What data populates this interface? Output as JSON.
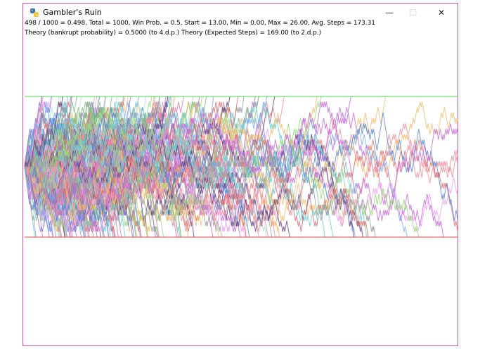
{
  "window": {
    "title": "Gambler's Ruin",
    "icon": "python-icon",
    "controls": {
      "minimize": "—",
      "maximize": "☐",
      "close": "✕"
    }
  },
  "stats_line": "498 / 1000 = 0.498, Total = 1000, Win Prob. = 0.5, Start = 13.00, Min = 0.00, Max = 26.00, Avg. Steps = 173.31",
  "theory_line": "Theory (bankrupt probability) = 0.5000 (to 4.d.p.)  Theory (Expected Steps) = 169.00 (to 2.d.p.)",
  "chart_data": {
    "type": "line",
    "description_series": "Random walk paths of 1000 gamblers starting at 13, absorbing at 0 and 26",
    "upper_barrier": 26,
    "lower_barrier": 0,
    "start": 13,
    "ylim": [
      0,
      26
    ],
    "upper_barrier_color": "#4cd04c",
    "lower_barrier_color": "#e04040",
    "path_colors": [
      "#c86fd8",
      "#7fb0f0",
      "#f08fa0",
      "#9ad87a",
      "#f0c070",
      "#8a7fd8",
      "#70d0d0",
      "#d87fa8",
      "#a0a0a0",
      "#6a4a8a",
      "#b0e0e0",
      "#f0a0f0",
      "#80c080",
      "#e07070",
      "#5a8ad0"
    ]
  }
}
